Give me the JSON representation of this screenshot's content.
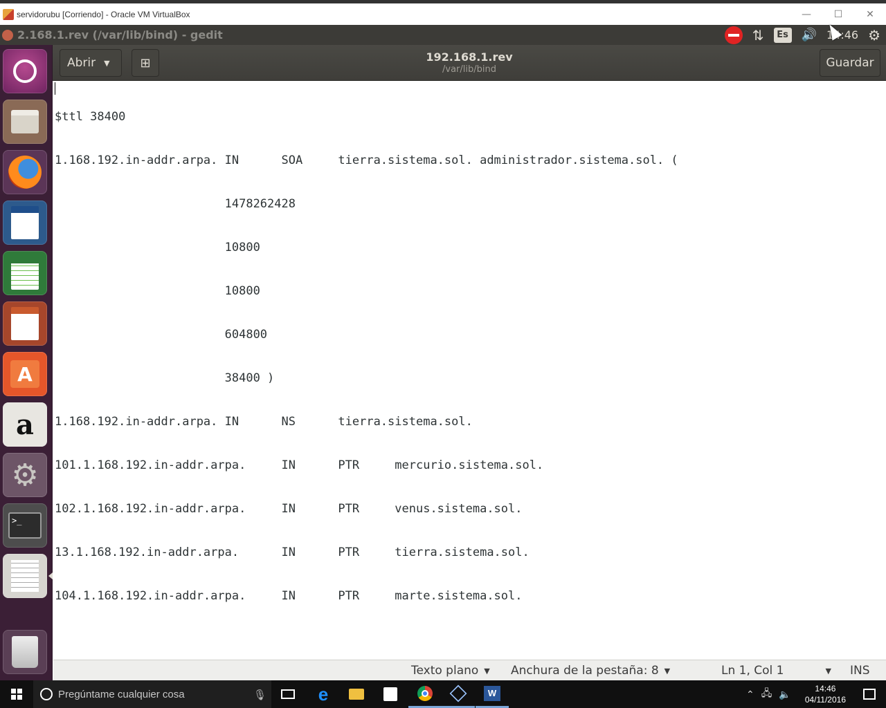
{
  "host_window": {
    "title": "servidorubu [Corriendo] - Oracle VM VirtualBox",
    "controls": {
      "minimize": "—",
      "maximize": "☐",
      "close": "✕"
    }
  },
  "ubuntu_panel": {
    "window_title": "2.168.1.rev (/var/lib/bind) - gedit",
    "keyboard_layout": "Es",
    "clock": "14:46"
  },
  "gedit": {
    "open_label": "Abrir",
    "doc_title": "192.168.1.rev",
    "doc_path": "/var/lib/bind",
    "save_label": "Guardar"
  },
  "editor": {
    "lines": [
      "$ttl 38400",
      "1.168.192.in-addr.arpa. IN      SOA     tierra.sistema.sol. administrador.sistema.sol. (",
      "                        1478262428",
      "                        10800",
      "                        10800",
      "                        604800",
      "                        38400 )",
      "1.168.192.in-addr.arpa. IN      NS      tierra.sistema.sol.",
      "101.1.168.192.in-addr.arpa.     IN      PTR     mercurio.sistema.sol.",
      "102.1.168.192.in-addr.arpa.     IN      PTR     venus.sistema.sol.",
      "13.1.168.192.in-addr.arpa.      IN      PTR     tierra.sistema.sol.",
      "104.1.168.192.in-addr.arpa.     IN      PTR     marte.sistema.sol."
    ]
  },
  "statusbar": {
    "language": "Texto plano",
    "tab_width": "Anchura de la pestaña: 8",
    "position": "Ln 1, Col 1",
    "mode": "INS"
  },
  "launcher": {
    "items": [
      "dash",
      "files",
      "firefox",
      "libreoffice-writer",
      "libreoffice-calc",
      "libreoffice-impress",
      "ubuntu-software",
      "amazon",
      "system-settings",
      "terminal",
      "gedit",
      "trash"
    ]
  },
  "taskbar": {
    "search_placeholder": "Pregúntame cualquier cosa",
    "time": "14:46",
    "date": "04/11/2016"
  }
}
